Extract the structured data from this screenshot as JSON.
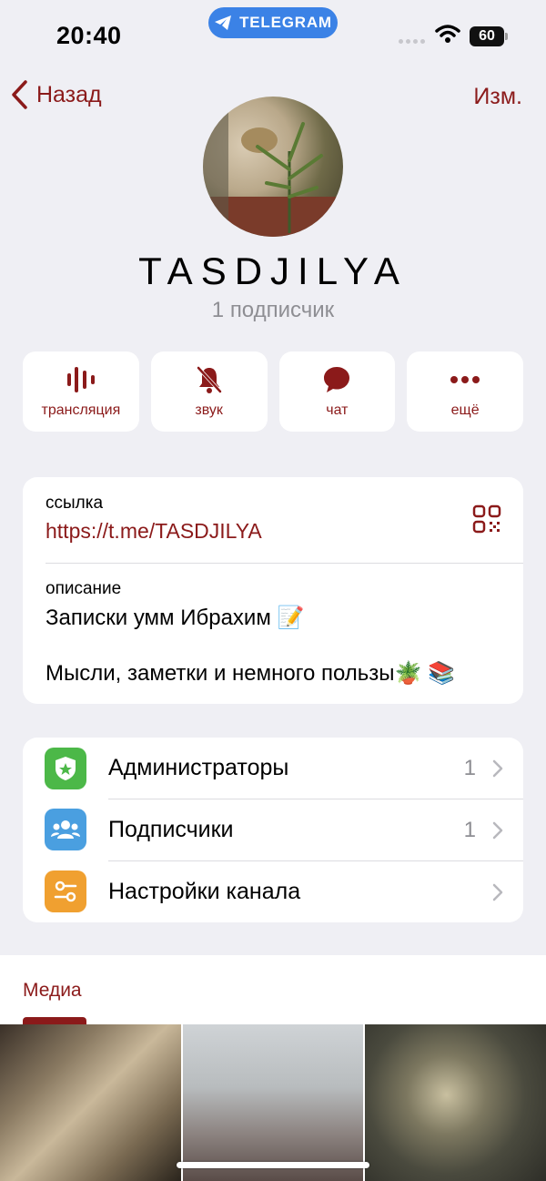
{
  "status_bar": {
    "time": "20:40",
    "app_pill": "TELEGRAM",
    "battery": "60"
  },
  "nav": {
    "back_label": "Назад",
    "edit_label": "Изм."
  },
  "channel": {
    "title": "TASDJILYA",
    "subscribers": "1 подписчик"
  },
  "actions": [
    {
      "label": "трансляция",
      "icon": "broadcast-icon"
    },
    {
      "label": "звук",
      "icon": "mute-bell-icon"
    },
    {
      "label": "чат",
      "icon": "chat-bubble-icon"
    },
    {
      "label": "ещё",
      "icon": "more-dots-icon"
    }
  ],
  "info": {
    "link_label": "ссылка",
    "link": "https://t.me/TASDJILYA",
    "description_label": "описание",
    "description_line1": "Записки умм Ибрахим 📝",
    "description_line2": "Мысли, заметки и немного пользы🪴 📚"
  },
  "settings": [
    {
      "label": "Администраторы",
      "count": "1",
      "icon": "admin-badge-icon",
      "color": "#4cb848"
    },
    {
      "label": "Подписчики",
      "count": "1",
      "icon": "users-icon",
      "color": "#4a9fe0"
    },
    {
      "label": "Настройки канала",
      "count": "",
      "icon": "channel-settings-icon",
      "color": "#f0a030"
    }
  ],
  "media": {
    "tab_label": "Медиа"
  },
  "colors": {
    "accent": "#8b1a1a",
    "background": "#efeff4"
  }
}
